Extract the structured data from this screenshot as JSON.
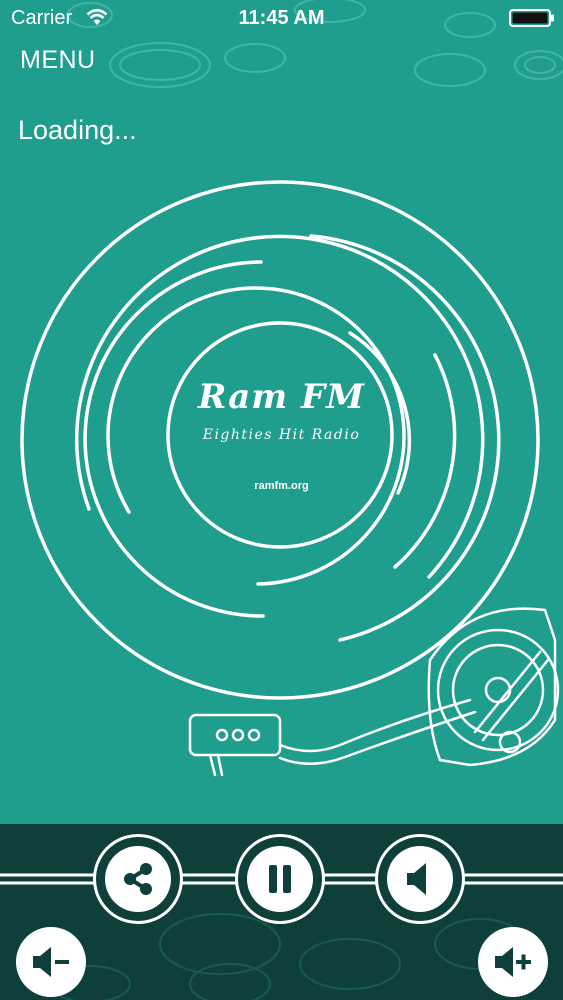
{
  "status_bar": {
    "carrier": "Carrier",
    "time": "11:45 AM"
  },
  "header": {
    "menu_label": "MENU",
    "loading_text": "Loading..."
  },
  "logo": {
    "title": "Ram FM",
    "tagline": "Eighties Hit Radio",
    "url": "ramfm.org"
  },
  "controls": {
    "share": {
      "icon": "share-icon"
    },
    "pause": {
      "icon": "pause-icon"
    },
    "mute": {
      "icon": "speaker-icon"
    },
    "volume_down": {
      "icon": "volume-down-icon"
    },
    "volume_up": {
      "icon": "volume-up-icon"
    }
  },
  "colors": {
    "background": "#1f9e8e",
    "control_bar": "#0f3f3b",
    "foreground": "#ffffff"
  }
}
